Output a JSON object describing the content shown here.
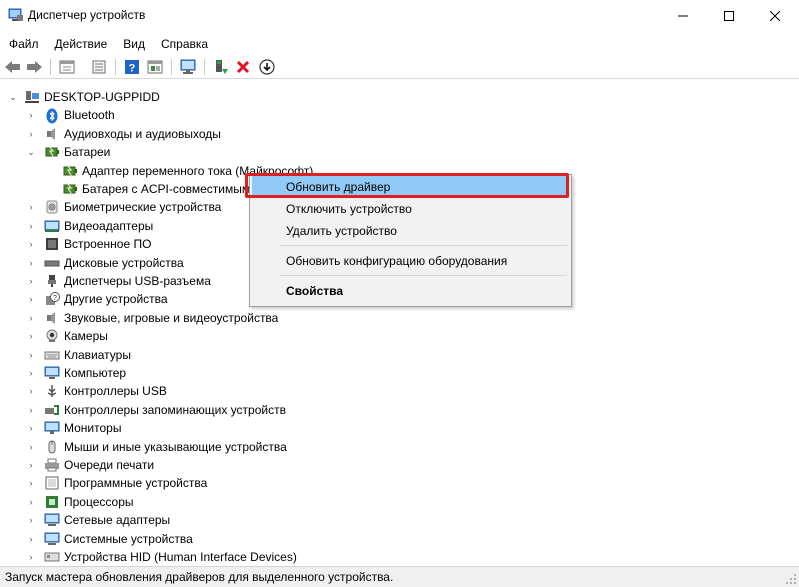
{
  "window": {
    "title": "Диспетчер устройств",
    "minimize": "—",
    "maximize": "☐",
    "close": "✕"
  },
  "menu": [
    "Файл",
    "Действие",
    "Вид",
    "Справка"
  ],
  "toolbar": [
    "back-icon",
    "forward-icon",
    "properties-view-icon",
    "driver-details-icon",
    "help-icon",
    "show-hidden-icon",
    "monitor-scan-icon",
    "enable-device-icon",
    "uninstall-x-icon",
    "update-driver-icon"
  ],
  "tree": {
    "root": "DESKTOP-UGPPIDD",
    "items": [
      {
        "label": "Bluetooth",
        "icon": "bluetooth-icon"
      },
      {
        "label": "Аудиовходы и аудиовыходы",
        "icon": "speaker-icon"
      },
      {
        "label": "Батареи",
        "icon": "battery-icon",
        "expanded": true,
        "children": [
          {
            "label": "Адаптер переменного тока (Майкрософт)",
            "icon": "battery-icon"
          },
          {
            "label": "Батарея с ACPI-совместимым управлением",
            "icon": "battery-icon"
          }
        ]
      },
      {
        "label": "Биометрические устройства",
        "icon": "fingerprint-icon"
      },
      {
        "label": "Видеоадаптеры",
        "icon": "display-adapter-icon"
      },
      {
        "label": "Встроенное ПО",
        "icon": "firmware-icon"
      },
      {
        "label": "Дисковые устройства",
        "icon": "disk-icon"
      },
      {
        "label": "Диспетчеры USB-разъема",
        "icon": "usb-connector-icon"
      },
      {
        "label": "Другие устройства",
        "icon": "unknown-device-icon"
      },
      {
        "label": "Звуковые, игровые и видеоустройства",
        "icon": "sound-icon"
      },
      {
        "label": "Камеры",
        "icon": "camera-icon"
      },
      {
        "label": "Клавиатуры",
        "icon": "keyboard-icon"
      },
      {
        "label": "Компьютер",
        "icon": "computer-icon"
      },
      {
        "label": "Контроллеры USB",
        "icon": "usb-icon"
      },
      {
        "label": "Контроллеры запоминающих устройств",
        "icon": "storage-controller-icon"
      },
      {
        "label": "Мониторы",
        "icon": "monitor-icon"
      },
      {
        "label": "Мыши и иные указывающие устройства",
        "icon": "mouse-icon"
      },
      {
        "label": "Очереди печати",
        "icon": "printer-icon"
      },
      {
        "label": "Программные устройства",
        "icon": "software-device-icon"
      },
      {
        "label": "Процессоры",
        "icon": "processor-icon"
      },
      {
        "label": "Сетевые адаптеры",
        "icon": "network-icon"
      },
      {
        "label": "Системные устройства",
        "icon": "system-icon"
      },
      {
        "label": "Устройства HID (Human Interface Devices)",
        "icon": "hid-icon"
      }
    ]
  },
  "context_menu": {
    "items": [
      {
        "label": "Обновить драйвер",
        "highlighted": true
      },
      {
        "label": "Отключить устройство"
      },
      {
        "label": "Удалить устройство"
      },
      {
        "label": "Обновить конфигурацию оборудования"
      },
      {
        "label": "Свойства",
        "bold": true
      }
    ]
  },
  "status": "Запуск мастера обновления драйверов для выделенного устройства.",
  "colors": {
    "highlight": "#91c9f7",
    "annotation_box": "#e02020",
    "toolbar_blue": "#1e63c7",
    "uninstall_red": "#e81123"
  }
}
